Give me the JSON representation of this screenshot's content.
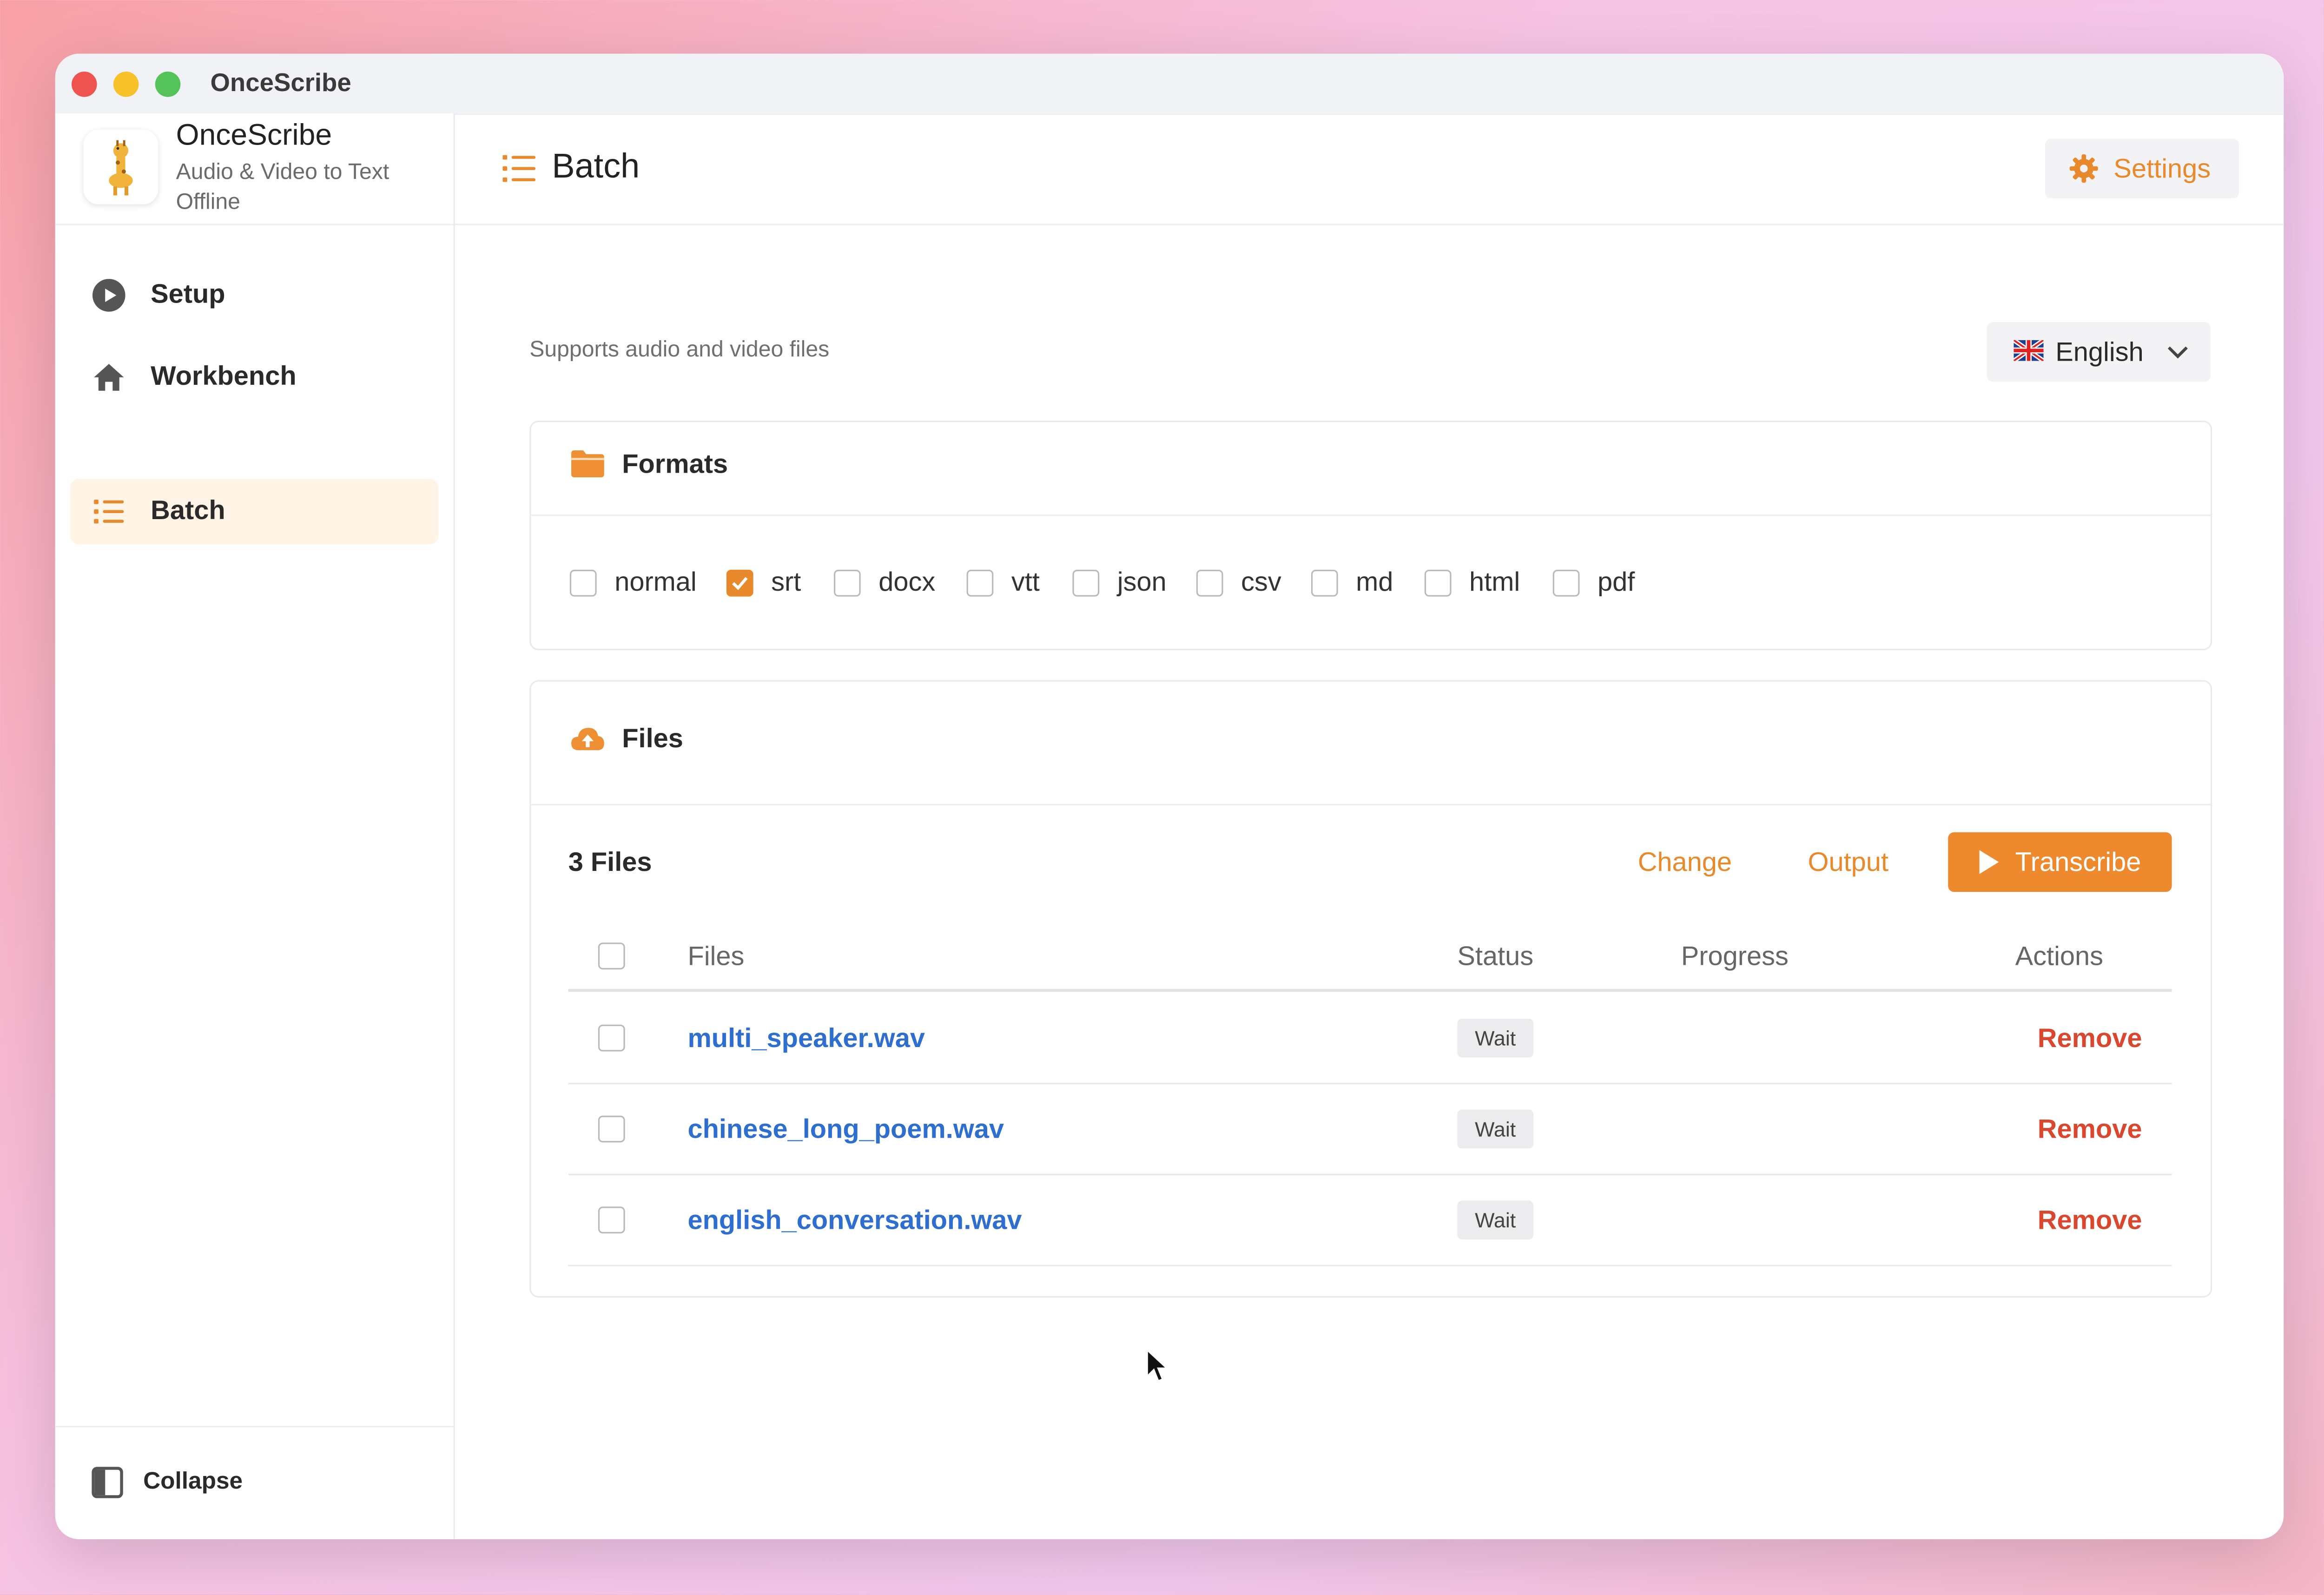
{
  "window": {
    "title": "OnceScribe"
  },
  "brand": {
    "name": "OnceScribe",
    "subtitle": "Audio & Video to Text Offline"
  },
  "sidebar": {
    "items": [
      {
        "label": "Setup",
        "icon": "play-circle-icon",
        "active": false
      },
      {
        "label": "Workbench",
        "icon": "home-icon",
        "active": false
      },
      {
        "label": "Batch",
        "icon": "list-icon",
        "active": true
      }
    ],
    "collapse_label": "Collapse"
  },
  "header": {
    "title": "Batch",
    "settings_label": "Settings"
  },
  "main": {
    "supports_text": "Supports audio and video files",
    "language": {
      "selected": "English",
      "flag": "uk-flag-icon"
    }
  },
  "formats": {
    "title": "Formats",
    "options": [
      {
        "label": "normal",
        "checked": false
      },
      {
        "label": "srt",
        "checked": true
      },
      {
        "label": "docx",
        "checked": false
      },
      {
        "label": "vtt",
        "checked": false
      },
      {
        "label": "json",
        "checked": false
      },
      {
        "label": "csv",
        "checked": false
      },
      {
        "label": "md",
        "checked": false
      },
      {
        "label": "html",
        "checked": false
      },
      {
        "label": "pdf",
        "checked": false
      }
    ]
  },
  "files": {
    "title": "Files",
    "count_label": "3 Files",
    "change_label": "Change",
    "output_label": "Output",
    "transcribe_label": "Transcribe",
    "columns": [
      "Files",
      "Status",
      "Progress",
      "Actions"
    ],
    "rows": [
      {
        "name": "multi_speaker.wav",
        "status": "Wait",
        "progress": "",
        "action": "Remove"
      },
      {
        "name": "chinese_long_poem.wav",
        "status": "Wait",
        "progress": "",
        "action": "Remove"
      },
      {
        "name": "english_conversation.wav",
        "status": "Wait",
        "progress": "",
        "action": "Remove"
      }
    ]
  },
  "colors": {
    "accent": "#e8892b",
    "link": "#2e6ecf",
    "danger": "#d9472f"
  }
}
